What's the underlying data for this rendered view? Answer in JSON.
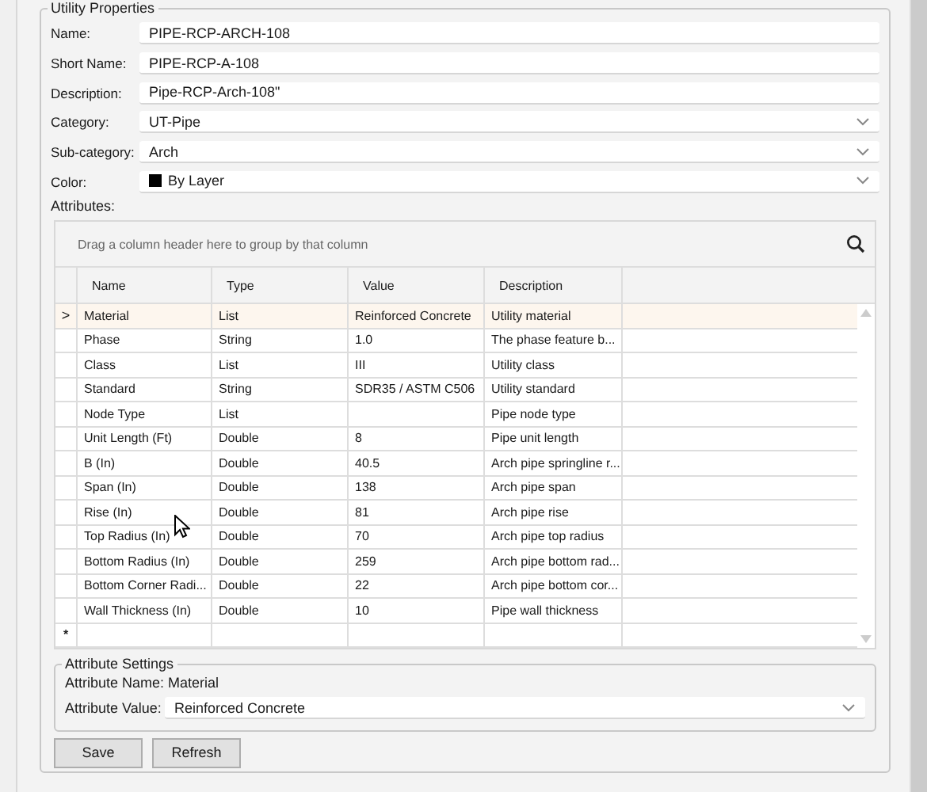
{
  "group_title": "Utility Properties",
  "fields": [
    {
      "label": "Name:",
      "kind": "text",
      "value": "PIPE-RCP-ARCH-108"
    },
    {
      "label": "Short Name:",
      "kind": "text",
      "value": "PIPE-RCP-A-108"
    },
    {
      "label": "Description:",
      "kind": "text",
      "value": "Pipe-RCP-Arch-108\""
    },
    {
      "label": "Category:",
      "kind": "dropdown",
      "value": "UT-Pipe"
    },
    {
      "label": "Sub-category:",
      "kind": "dropdown",
      "value": "Arch"
    },
    {
      "label": "Color:",
      "kind": "color",
      "value": "By Layer",
      "color": "#000000"
    }
  ],
  "attributes_label": "Attributes:",
  "grid": {
    "group_panel_hint": "Drag a column header here to group by that column",
    "columns": [
      "Name",
      "Type",
      "Value",
      "Description"
    ],
    "current_row_marker": ">",
    "new_row_marker": "*",
    "rows": [
      {
        "selected": true,
        "name": "Material",
        "type": "List",
        "value": "Reinforced Concrete",
        "description": "Utility material"
      },
      {
        "selected": false,
        "name": "Phase",
        "type": "String",
        "value": "1.0",
        "description": "The phase feature b..."
      },
      {
        "selected": false,
        "name": "Class",
        "type": "List",
        "value": "III",
        "description": "Utility class"
      },
      {
        "selected": false,
        "name": "Standard",
        "type": "String",
        "value": "SDR35 / ASTM C506",
        "description": "Utility standard"
      },
      {
        "selected": false,
        "name": "Node Type",
        "type": "List",
        "description": "Pipe node type"
      },
      {
        "selected": false,
        "name": "Unit Length (Ft)",
        "type": "Double",
        "value": "8",
        "description": "Pipe unit length"
      },
      {
        "selected": false,
        "name": "B (In)",
        "type": "Double",
        "value": "40.5",
        "description": "Arch pipe springline r..."
      },
      {
        "selected": false,
        "name": "Span (In)",
        "type": "Double",
        "value": "138",
        "description": "Arch pipe span"
      },
      {
        "selected": false,
        "name": "Rise (In)",
        "type": "Double",
        "value": "81",
        "description": "Arch pipe rise"
      },
      {
        "selected": false,
        "name": "Top Radius (In)",
        "type": "Double",
        "value": "70",
        "description": "Arch pipe top radius"
      },
      {
        "selected": false,
        "name": "Bottom Radius (In)",
        "type": "Double",
        "value": "259",
        "description": "Arch pipe bottom rad..."
      },
      {
        "selected": false,
        "name": "Bottom Corner Radi...",
        "type": "Double",
        "value": "22",
        "description": "Arch pipe bottom cor..."
      },
      {
        "selected": false,
        "name": "Wall Thickness (In)",
        "type": "Double",
        "value": "10",
        "description": "Pipe wall thickness"
      }
    ]
  },
  "attribute_settings": {
    "title": "Attribute Settings",
    "name_text": "Attribute Name: Material",
    "value_label": "Attribute Value:",
    "value": "Reinforced Concrete"
  },
  "buttons": [
    "Save",
    "Refresh"
  ]
}
